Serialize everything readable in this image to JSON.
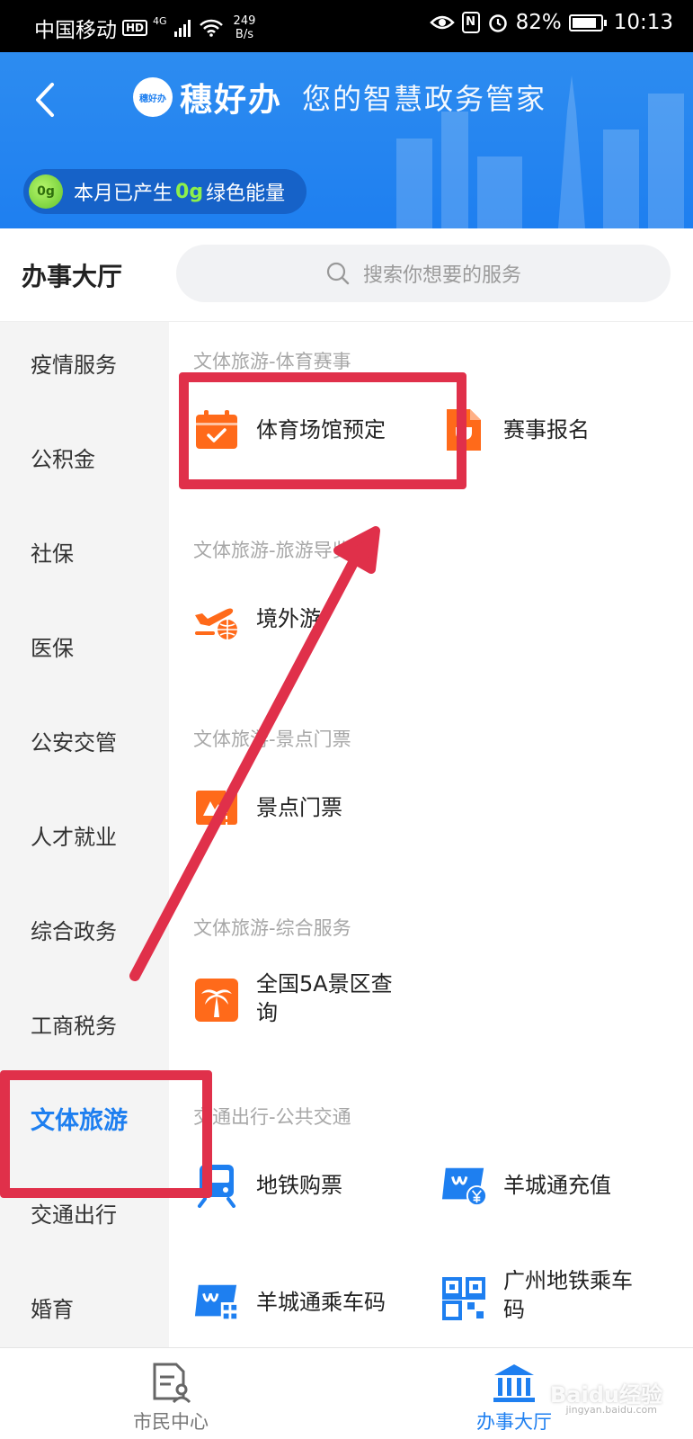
{
  "status_bar": {
    "carrier": "中国移动",
    "hd": "HD",
    "network": "4G",
    "speed_value": "249",
    "speed_unit": "B/s",
    "battery": "82%",
    "time": "10:13"
  },
  "header": {
    "logo_text": "穗好办",
    "app_name": "穗好办",
    "slogan": "您的智慧政务管家",
    "energy": {
      "badge": "0g",
      "prefix": "本月已产生",
      "value": "0g",
      "suffix": "绿色能量"
    }
  },
  "hall": {
    "title": "办事大厅",
    "search_placeholder": "搜索你想要的服务"
  },
  "sidebar": {
    "items": [
      {
        "label": "疫情服务"
      },
      {
        "label": "公积金"
      },
      {
        "label": "社保"
      },
      {
        "label": "医保"
      },
      {
        "label": "公安交管"
      },
      {
        "label": "人才就业"
      },
      {
        "label": "综合政务"
      },
      {
        "label": "工商税务"
      },
      {
        "label": "文体旅游",
        "active": true
      },
      {
        "label": "交通出行"
      },
      {
        "label": "婚育"
      }
    ]
  },
  "sections": [
    {
      "title": "文体旅游-体育赛事",
      "services": [
        {
          "label": "体育场馆预定",
          "icon": "calendar-check-icon"
        },
        {
          "label": "赛事报名",
          "icon": "trophy-doc-icon"
        }
      ]
    },
    {
      "title": "文体旅游-旅游导览",
      "services": [
        {
          "label": "境外游",
          "icon": "airplane-globe-icon"
        }
      ]
    },
    {
      "title": "文体旅游-景点门票",
      "services": [
        {
          "label": "景点门票",
          "icon": "ticket-icon"
        }
      ]
    },
    {
      "title": "文体旅游-综合服务",
      "services": [
        {
          "label": "全国5A景区查询",
          "label_line1": "全国5A景区查",
          "label_line2": "询",
          "icon": "palm-tree-icon"
        }
      ]
    },
    {
      "title": "交通出行-公共交通",
      "services": [
        {
          "label": "地铁购票",
          "icon": "metro-icon"
        },
        {
          "label": "羊城通充值",
          "icon": "card-yen-icon"
        },
        {
          "label": "羊城通乘车码",
          "icon": "card-qr-icon"
        },
        {
          "label": "广州地铁乘车码",
          "label_line1": "广州地铁乘车",
          "label_line2": "码",
          "icon": "qr-code-icon"
        }
      ]
    }
  ],
  "bottom_nav": [
    {
      "label": "市民中心",
      "icon": "citizen-doc-icon",
      "active": false
    },
    {
      "label": "办事大厅",
      "icon": "government-hall-icon",
      "active": true
    }
  ],
  "watermark": {
    "text": "Baidu经验",
    "sub": "jingyan.baidu.com"
  },
  "colors": {
    "brand_blue": "#1e7ff0",
    "icon_orange": "#ff6a1a",
    "annotation_red": "#e0304a",
    "energy_green": "#8df04b"
  }
}
